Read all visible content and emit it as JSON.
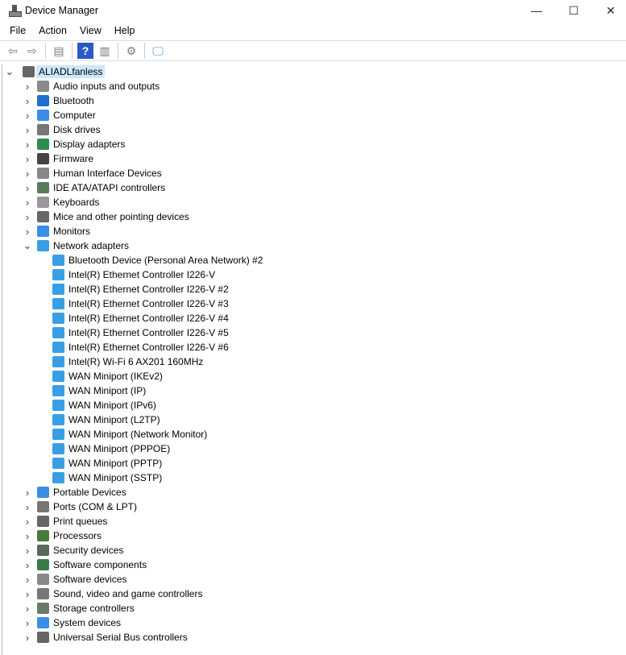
{
  "window": {
    "title": "Device Manager",
    "minimize": "—",
    "maximize": "☐",
    "close": "✕"
  },
  "menu": [
    "File",
    "Action",
    "View",
    "Help"
  ],
  "toolbar": [
    {
      "name": "back-icon",
      "glyph": "⇦"
    },
    {
      "name": "forward-icon",
      "glyph": "⇨"
    },
    {
      "sep": true
    },
    {
      "name": "show-hide-console-tree-icon",
      "glyph": "▤"
    },
    {
      "sep": true
    },
    {
      "name": "help-icon",
      "glyph": "?"
    },
    {
      "name": "action-pane-icon",
      "glyph": "▥"
    },
    {
      "sep": true
    },
    {
      "name": "update-driver-icon",
      "glyph": "⚙"
    },
    {
      "sep": true
    },
    {
      "name": "scan-hardware-icon",
      "glyph": "🖵"
    }
  ],
  "tree": {
    "root": "ALIADLfanless",
    "categories": [
      {
        "label": "Audio inputs and outputs",
        "color": "#8a8a8a"
      },
      {
        "label": "Bluetooth",
        "color": "#1f6fd1"
      },
      {
        "label": "Computer",
        "color": "#3a8ee6"
      },
      {
        "label": "Disk drives",
        "color": "#777777"
      },
      {
        "label": "Display adapters",
        "color": "#2f8c4a"
      },
      {
        "label": "Firmware",
        "color": "#444444"
      },
      {
        "label": "Human Interface Devices",
        "color": "#888888"
      },
      {
        "label": "IDE ATA/ATAPI controllers",
        "color": "#5a7a5a"
      },
      {
        "label": "Keyboards",
        "color": "#999999"
      },
      {
        "label": "Mice and other pointing devices",
        "color": "#666666"
      },
      {
        "label": "Monitors",
        "color": "#3a8ee6"
      },
      {
        "label": "Network adapters",
        "color": "#3a9ee6",
        "expanded": true,
        "children": [
          "Bluetooth Device (Personal Area Network) #2",
          "Intel(R) Ethernet Controller I226-V",
          "Intel(R) Ethernet Controller I226-V #2",
          "Intel(R) Ethernet Controller I226-V #3",
          "Intel(R) Ethernet Controller I226-V #4",
          "Intel(R) Ethernet Controller I226-V #5",
          "Intel(R) Ethernet Controller I226-V #6",
          "Intel(R) Wi-Fi 6 AX201 160MHz",
          "WAN Miniport (IKEv2)",
          "WAN Miniport (IP)",
          "WAN Miniport (IPv6)",
          "WAN Miniport (L2TP)",
          "WAN Miniport (Network Monitor)",
          "WAN Miniport (PPPOE)",
          "WAN Miniport (PPTP)",
          "WAN Miniport (SSTP)"
        ]
      },
      {
        "label": "Portable Devices",
        "color": "#3a8ee6"
      },
      {
        "label": "Ports (COM & LPT)",
        "color": "#777777"
      },
      {
        "label": "Print queues",
        "color": "#666666"
      },
      {
        "label": "Processors",
        "color": "#4a7a3a"
      },
      {
        "label": "Security devices",
        "color": "#5a6a5a"
      },
      {
        "label": "Software components",
        "color": "#3a7a4a"
      },
      {
        "label": "Software devices",
        "color": "#888888"
      },
      {
        "label": "Sound, video and game controllers",
        "color": "#777777"
      },
      {
        "label": "Storage controllers",
        "color": "#6a7a6a"
      },
      {
        "label": "System devices",
        "color": "#3a8ee6"
      },
      {
        "label": "Universal Serial Bus controllers",
        "color": "#666666"
      }
    ]
  }
}
